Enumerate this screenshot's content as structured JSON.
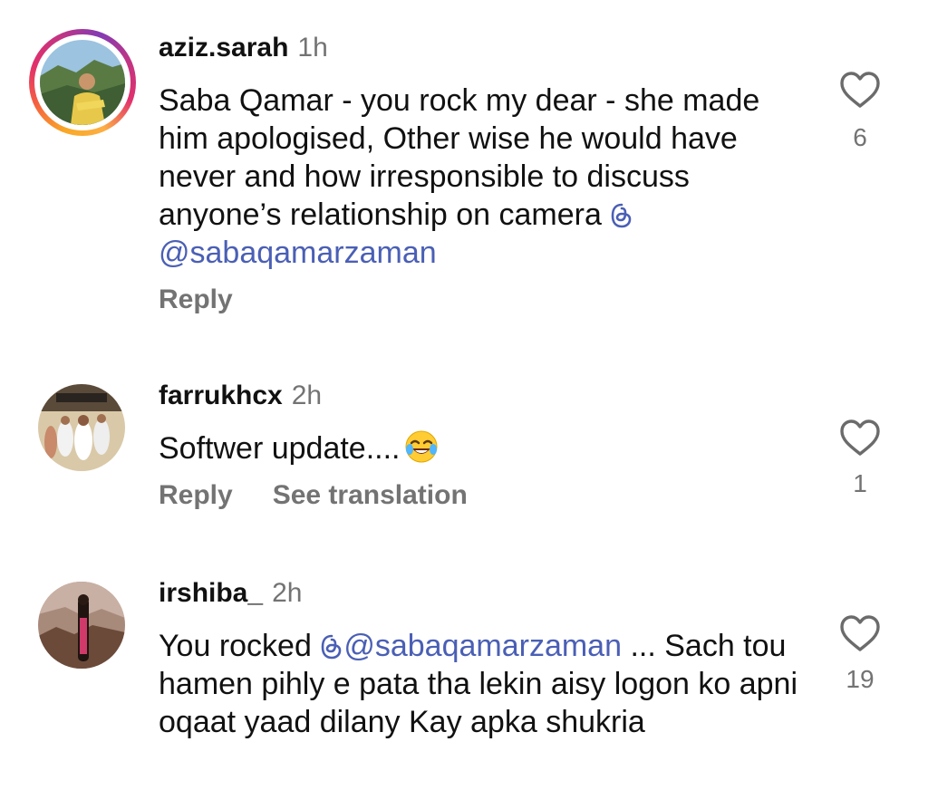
{
  "comments": [
    {
      "username": "aziz.sarah",
      "time": "1h",
      "text_before": "Saba Qamar - you rock my dear - she made him apologised, Other wise he would have never and how irresponsible to discuss anyone’s relationship on camera ",
      "mention": "@sabaqamarzaman",
      "text_after": "",
      "reply_label": "Reply",
      "likes": "6"
    },
    {
      "username": "farrukhcx",
      "time": "2h",
      "text_before": "Softwer update....",
      "emoji": "face-with-tears-of-joy",
      "reply_label": "Reply",
      "translate_label": "See translation",
      "likes": "1"
    },
    {
      "username": "irshiba_",
      "time": "2h",
      "text_before": "You rocked ",
      "mention": "@sabaqamarzaman",
      "text_after": " ... Sach tou hamen pihly e pata tha lekin aisy logon ko apni oqaat yaad dilany Kay apka shukria",
      "likes": "19"
    }
  ],
  "colors": {
    "mention": "#4a5fb5",
    "muted": "#737373",
    "text": "#111111"
  },
  "icons": {
    "like": "heart-outline-icon",
    "mention_prefix": "threads-icon"
  }
}
